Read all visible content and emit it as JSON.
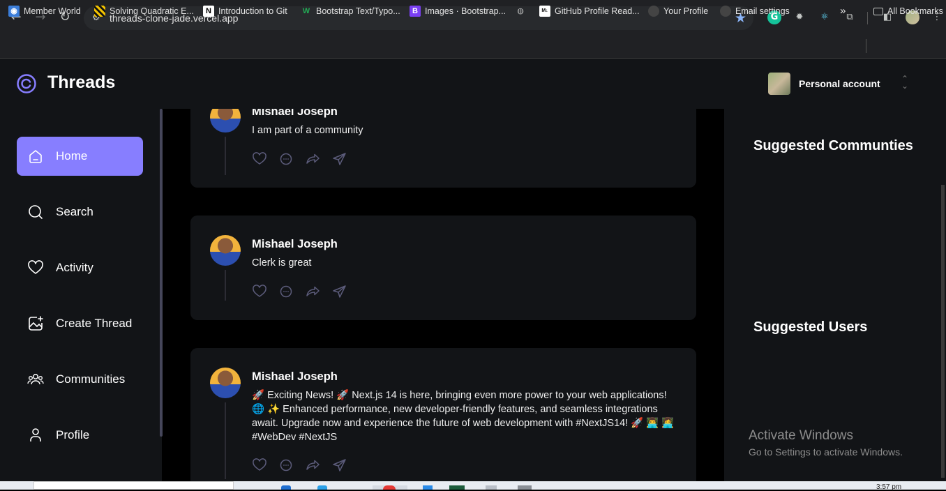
{
  "browser": {
    "url": "threads-clone-jade.vercel.app",
    "bookmarks": [
      {
        "label": "Member World",
        "icon": "member-world-icon",
        "color": "#3b7dd8"
      },
      {
        "label": "Solving Quadratic E...",
        "icon": "stripes-icon",
        "color": "#f2c200"
      },
      {
        "label": "Introduction to Git",
        "icon": "notion-icon",
        "color": "#ffffff"
      },
      {
        "label": "Bootstrap Text/Typo...",
        "icon": "w-icon",
        "color": "#22aa55"
      },
      {
        "label": "Images · Bootstrap...",
        "icon": "bootstrap-icon",
        "color": "#7a3ff2"
      },
      {
        "label": "",
        "icon": "globe-icon",
        "color": "#bbbbbb"
      },
      {
        "label": "GitHub Profile Read...",
        "icon": "readme-icon",
        "color": "#ffffff"
      },
      {
        "label": "Your Profile",
        "icon": "github-icon",
        "color": "#444444"
      },
      {
        "label": "Email settings",
        "icon": "github-icon",
        "color": "#444444"
      }
    ],
    "more": "»",
    "all_bookmarks": "All Bookmarks"
  },
  "app": {
    "title": "Threads",
    "accent": "#877eff",
    "account_label": "Personal account"
  },
  "sidebar": {
    "items": [
      {
        "label": "Home",
        "icon": "home-icon",
        "active": true
      },
      {
        "label": "Search",
        "icon": "search-icon",
        "active": false
      },
      {
        "label": "Activity",
        "icon": "heart-icon",
        "active": false
      },
      {
        "label": "Create Thread",
        "icon": "create-thread-icon",
        "active": false
      },
      {
        "label": "Communities",
        "icon": "communities-icon",
        "active": false
      },
      {
        "label": "Profile",
        "icon": "profile-icon",
        "active": false
      }
    ]
  },
  "feed": {
    "threads": [
      {
        "author": "Mishael Joseph",
        "text": "I am part of a community"
      },
      {
        "author": "Mishael Joseph",
        "text": "Clerk is great"
      },
      {
        "author": "Mishael Joseph",
        "text": "🚀 Exciting News! 🚀 Next.js 14 is here, bringing even more power to your web applications! 🌐 ✨ Enhanced performance, new developer-friendly features, and seamless integrations await. Upgrade now and experience the future of web development with #NextJS14! 🚀 👨‍💻 👩‍💻 #WebDev #NextJS"
      }
    ]
  },
  "right_sidebar": {
    "suggested_communities": "Suggested Communties",
    "suggested_users": "Suggested Users"
  },
  "watermark": {
    "line1": "Activate Windows",
    "line2": "Go to Settings to activate Windows."
  },
  "taskbar": {
    "clock": "3:57 pm"
  }
}
